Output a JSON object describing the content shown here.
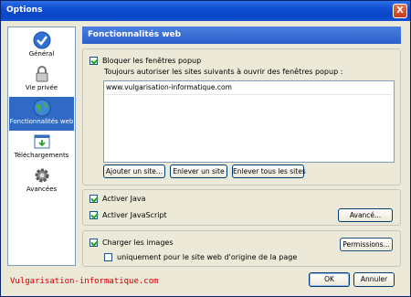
{
  "window": {
    "title": "Options",
    "close_label": "X"
  },
  "sidebar": {
    "items": [
      {
        "label": "Général",
        "icon": "checkmark-icon"
      },
      {
        "label": "Vie privée",
        "icon": "padlock-icon"
      },
      {
        "label": "Fonctionnalités web",
        "icon": "globe-icon",
        "selected": true
      },
      {
        "label": "Téléchargements",
        "icon": "download-window-icon"
      },
      {
        "label": "Avancées",
        "icon": "gear-icon"
      }
    ]
  },
  "header": {
    "title": "Fonctionnalités web"
  },
  "popup": {
    "checkbox_label": "Bloquer les fenêtres popup",
    "checked": true,
    "description": "Toujours autoriser les sites suivants à ouvrir des fenêtres popup :",
    "sites": [
      "www.vulgarisation-informatique.com"
    ],
    "add_button": "Ajouter un site...",
    "remove_button": "Enlever un site",
    "remove_all_button": "Enlever tous les sites"
  },
  "java": {
    "java_label": "Activer Java",
    "java_checked": true,
    "js_label": "Activer JavaScript",
    "js_checked": true,
    "advanced_button": "Avancé..."
  },
  "images": {
    "load_label": "Charger les images",
    "load_checked": true,
    "origin_label": "uniquement pour le site web d'origine de la page",
    "origin_checked": false,
    "permissions_button": "Permissions..."
  },
  "footer": {
    "watermark": "Vulgarisation-informatique.com",
    "ok_button": "OK",
    "cancel_button": "Annuler"
  }
}
